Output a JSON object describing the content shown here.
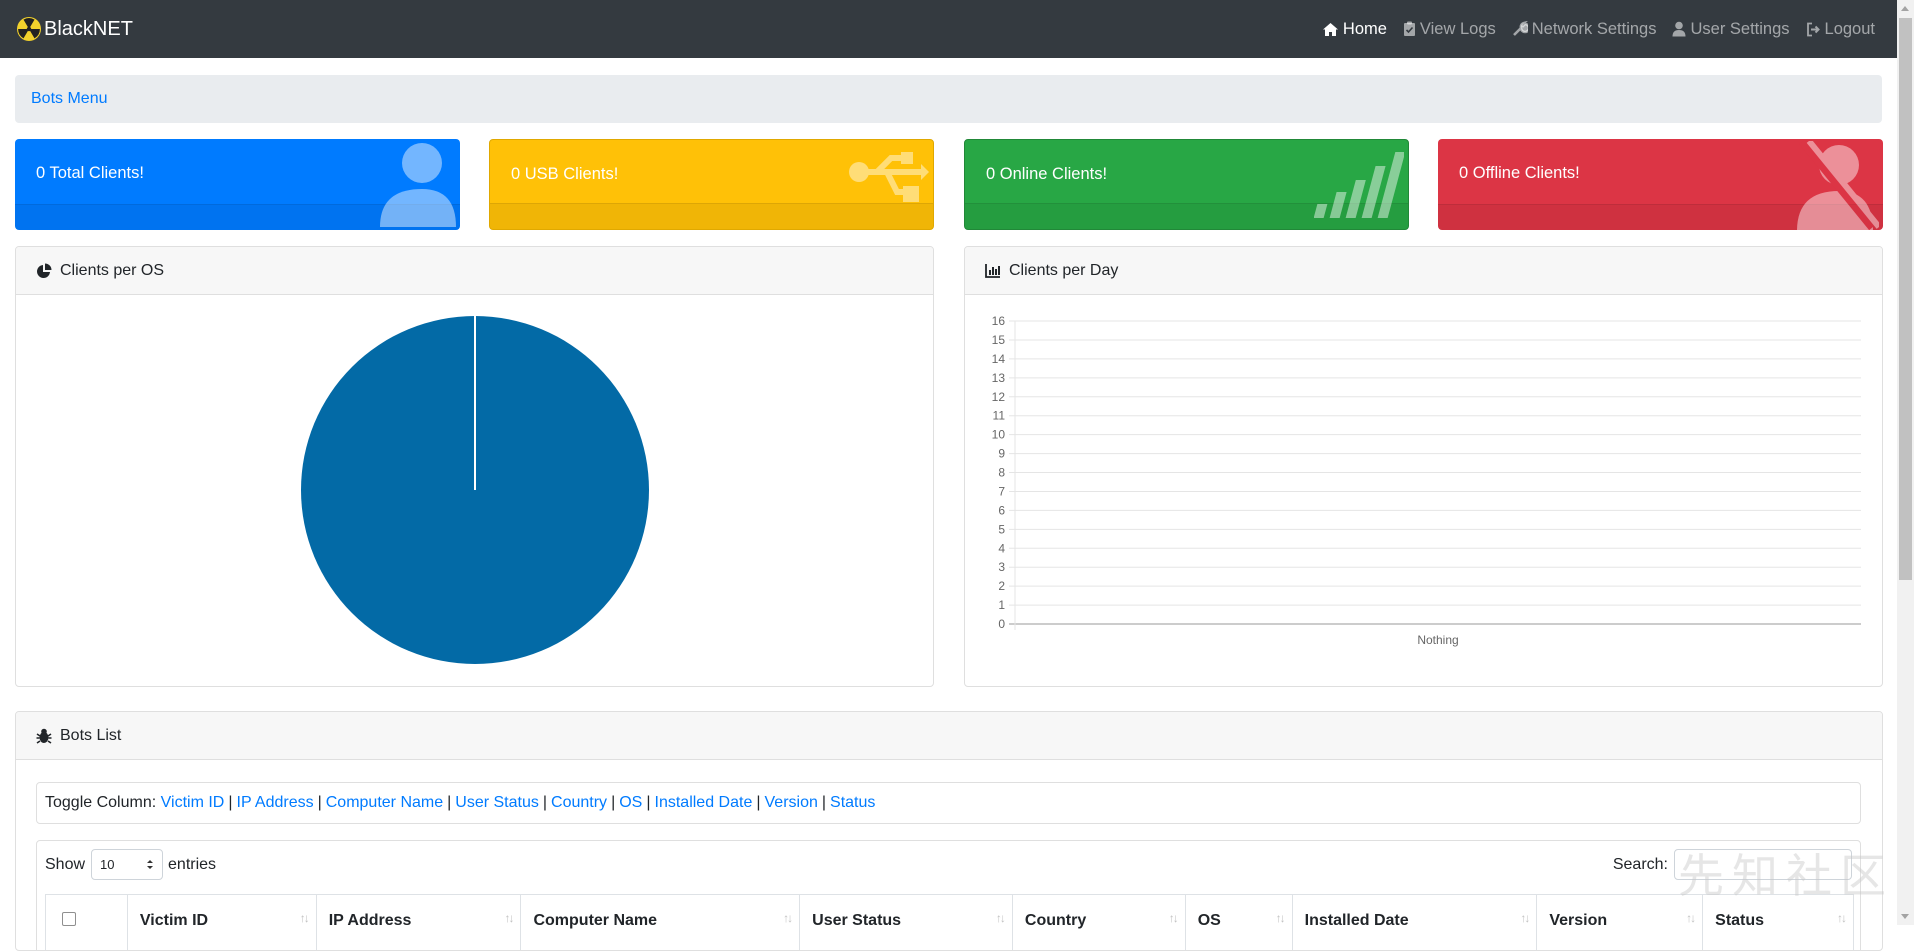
{
  "app": {
    "brand": "BlackNET"
  },
  "nav": {
    "items": [
      {
        "label": "Home",
        "active": true
      },
      {
        "label": "View Logs"
      },
      {
        "label": "Network Settings"
      },
      {
        "label": "User Settings"
      },
      {
        "label": "Logout"
      }
    ]
  },
  "breadcrumb": {
    "label": "Bots Menu"
  },
  "stats": {
    "total": "0 Total Clients!",
    "usb": "0 USB Clients!",
    "online": "0 Online Clients!",
    "offline": "0 Offline Clients!"
  },
  "colors": {
    "blue": "#007bff",
    "yellow": "#ffc107",
    "green": "#28a745",
    "red": "#dc3545",
    "pie": "#036aa6"
  },
  "os_panel": {
    "title": "Clients per OS"
  },
  "day_panel": {
    "title": "Clients per Day"
  },
  "chart_data": {
    "type": "line",
    "categories": [
      "Nothing"
    ],
    "series": [
      {
        "values": [
          0
        ]
      }
    ],
    "ylim": [
      0,
      16
    ],
    "yticks": [
      "16",
      "15",
      "14",
      "13",
      "12",
      "11",
      "10",
      "9",
      "8",
      "7",
      "6",
      "5",
      "4",
      "3",
      "2",
      "1",
      "0"
    ],
    "grid": true
  },
  "bots_panel": {
    "title": "Bots List",
    "toggle_label": "Toggle Column:",
    "toggle_columns": [
      "Victim ID",
      "IP Address",
      "Computer Name",
      "User Status",
      "Country",
      "OS",
      "Installed Date",
      "Version",
      "Status"
    ],
    "show_label": "Show",
    "entries_value": "10",
    "entries_label": "entries",
    "search_label": "Search:",
    "columns": [
      "Victim ID",
      "IP Address",
      "Computer Name",
      "User Status",
      "Country",
      "OS",
      "Installed Date",
      "Version",
      "Status"
    ]
  },
  "watermark": "先知社区"
}
